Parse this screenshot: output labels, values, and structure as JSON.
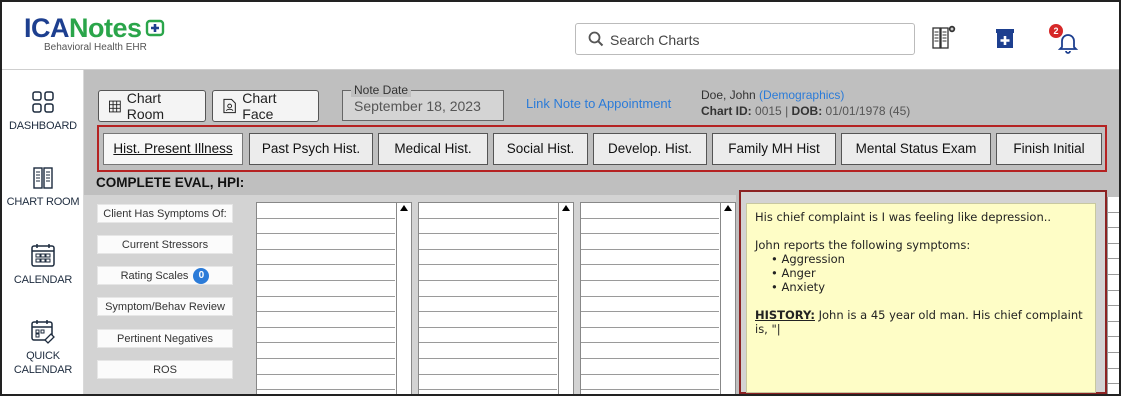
{
  "brand": {
    "logo_ica": "ICA",
    "logo_notes": "Notes",
    "tagline": "Behavioral Health EHR",
    "color_blue": "#1d3f8f",
    "color_green": "#2aa54a"
  },
  "header": {
    "search_placeholder": "Search Charts",
    "icons": [
      "search-icon",
      "chart-room-icon",
      "pharmacy-icon",
      "notifications-bell-icon"
    ],
    "notification_count": "2"
  },
  "sidebar": {
    "items": [
      {
        "label": "DASHBOARD",
        "icon": "dashboard-icon"
      },
      {
        "label": "CHART ROOM",
        "icon": "chart-room-icon"
      },
      {
        "label": "CALENDAR",
        "icon": "calendar-icon"
      },
      {
        "label": "QUICK CALENDAR",
        "icon": "quick-calendar-icon"
      }
    ]
  },
  "toolbar": {
    "chart_room_label": "Chart Room",
    "chart_face_label": "Chart Face",
    "note_date_legend": "Note Date",
    "note_date_value": "September 18, 2023",
    "link_note_label": "Link Note to Appointment"
  },
  "patient": {
    "name": "Doe, John",
    "demographics_link": "(Demographics)",
    "chart_id_label": "Chart ID:",
    "chart_id": "0015",
    "separator": "|",
    "dob_label": "DOB:",
    "dob": "01/01/1978 (45)"
  },
  "tabs": [
    {
      "label": "Hist. Present Illness",
      "active": true
    },
    {
      "label": "Past Psych Hist.",
      "active": false
    },
    {
      "label": "Medical Hist.",
      "active": false
    },
    {
      "label": "Social Hist.",
      "active": false
    },
    {
      "label": "Develop. Hist.",
      "active": false
    },
    {
      "label": "Family MH Hist",
      "active": false
    },
    {
      "label": "Mental Status Exam",
      "active": false
    },
    {
      "label": "Finish Initial",
      "active": false
    }
  ],
  "section_title": "COMPLETE EVAL, HPI:",
  "options": [
    {
      "label": "Client Has Symptoms Of:"
    },
    {
      "label": "Current Stressors"
    },
    {
      "label": "Rating Scales",
      "count": "0"
    },
    {
      "label": "Symptom/Behav Review"
    },
    {
      "label": "Pertinent Negatives"
    },
    {
      "label": "ROS"
    }
  ],
  "note": {
    "line1": "His chief complaint is I was feeling like depression..",
    "line2": "John reports the following symptoms:",
    "symptoms": [
      "Aggression",
      "Anger",
      "Anxiety"
    ],
    "history_label": "HISTORY:",
    "history_text": " John is a 45 year old man. His chief complaint is, \"|"
  }
}
